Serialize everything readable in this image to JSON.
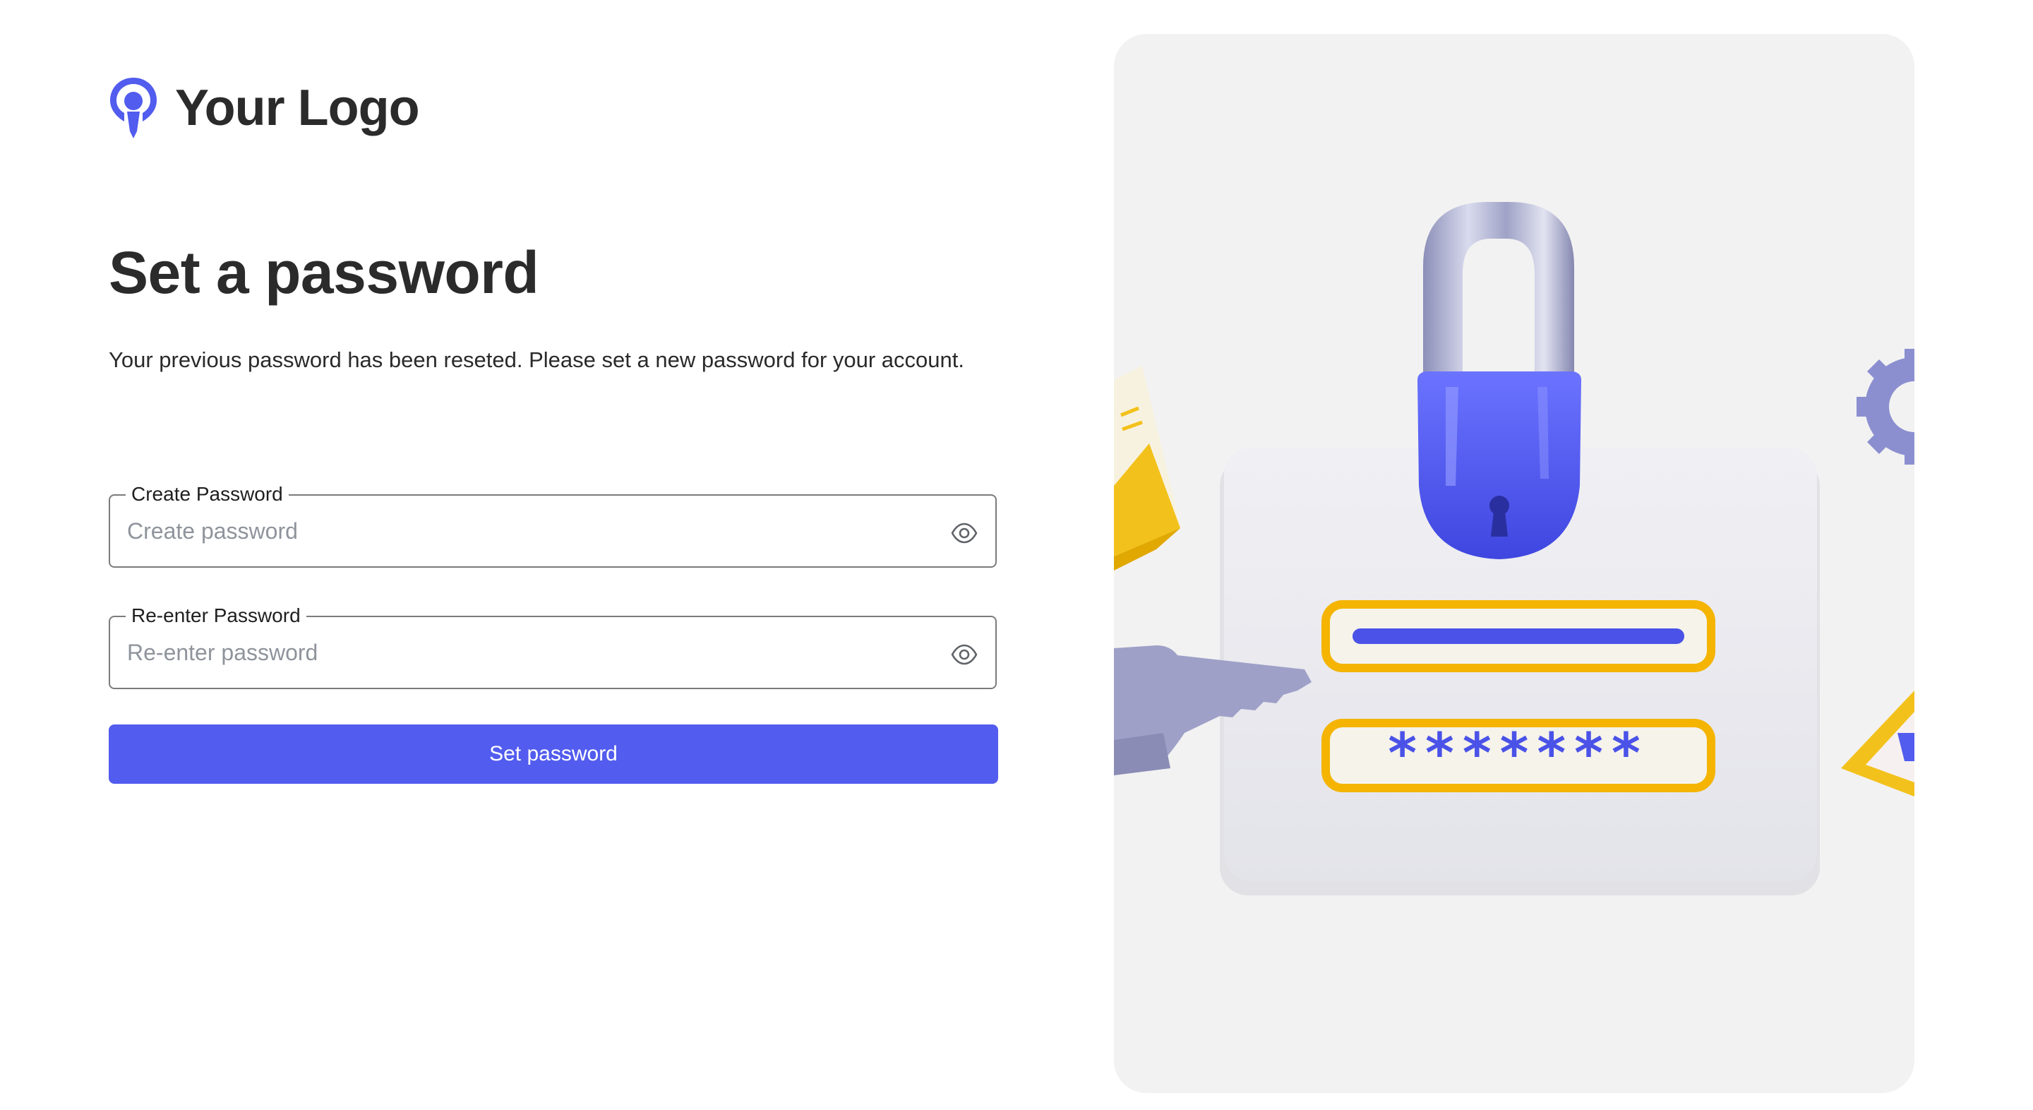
{
  "brand": {
    "logo_text": "Your Logo",
    "accent_color": "#525cee",
    "logo_icon": "location-pin-logo-icon"
  },
  "main": {
    "title": "Set a password",
    "subtitle": "Your previous password has been reseted. Please set a new password for your account."
  },
  "form": {
    "create_password": {
      "label": "Create Password",
      "placeholder": "Create password",
      "value": "",
      "toggle_icon": "eye-icon"
    },
    "reenter_password": {
      "label": "Re-enter Password",
      "placeholder": "Re-enter password",
      "value": "",
      "toggle_icon": "eye-icon"
    },
    "submit_label": "Set password"
  },
  "illustration": {
    "masked_password": "*******",
    "colors": {
      "padlock": "#525cee",
      "field_border": "#f4b400",
      "card": "#e9e9ee",
      "key": "#9ea0c8"
    }
  }
}
